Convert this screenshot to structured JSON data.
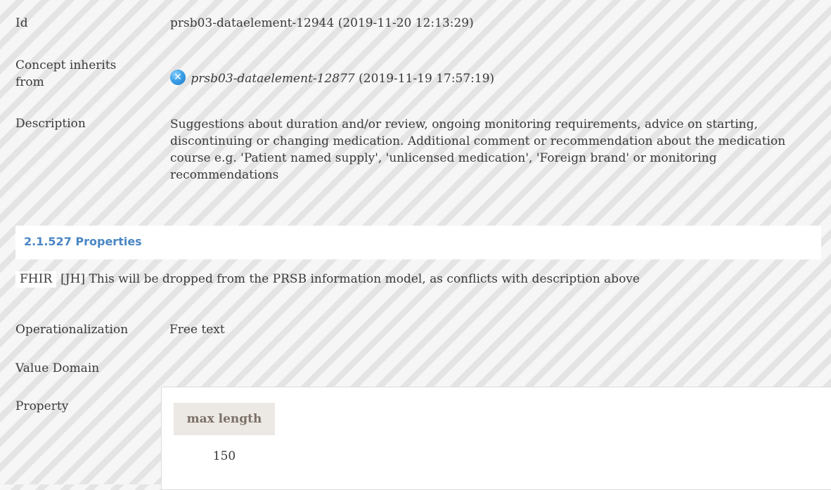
{
  "id_row": {
    "label": "Id",
    "value": "prsb03-dataelement-12944 (2019-11-20 12:13:29)"
  },
  "inherit_row": {
    "label": "Concept inherits from",
    "icon": "inherit-icon",
    "ref": "prsb03-dataelement-12877",
    "date": " (2019-11-19 17:57:19)"
  },
  "description_row": {
    "label": "Description",
    "value": "Suggestions about duration and/or review, ongoing monitoring requirements, advice on starting, discontinuing or changing medication. Additional comment or recommendation about the medication course e.g. 'Patient named supply', 'unlicensed medication', 'Foreign brand' or monitoring recommendations"
  },
  "properties_section": {
    "title": "2.1.527 Properties"
  },
  "fhir_row": {
    "badge": "FHIR",
    "comment": "[JH] This will be dropped from the PRSB information model, as conflicts with description above"
  },
  "operationalization_row": {
    "label": "Operationalization",
    "value": "Free text"
  },
  "value_domain_row": {
    "label": "Value Domain"
  },
  "property_row": {
    "label": "Property",
    "table_header": "max length",
    "table_value": "150"
  },
  "colors": {
    "section_title": "#4a86c4",
    "text": "#3a3a3a",
    "table_header_bg": "#ece8e3"
  }
}
